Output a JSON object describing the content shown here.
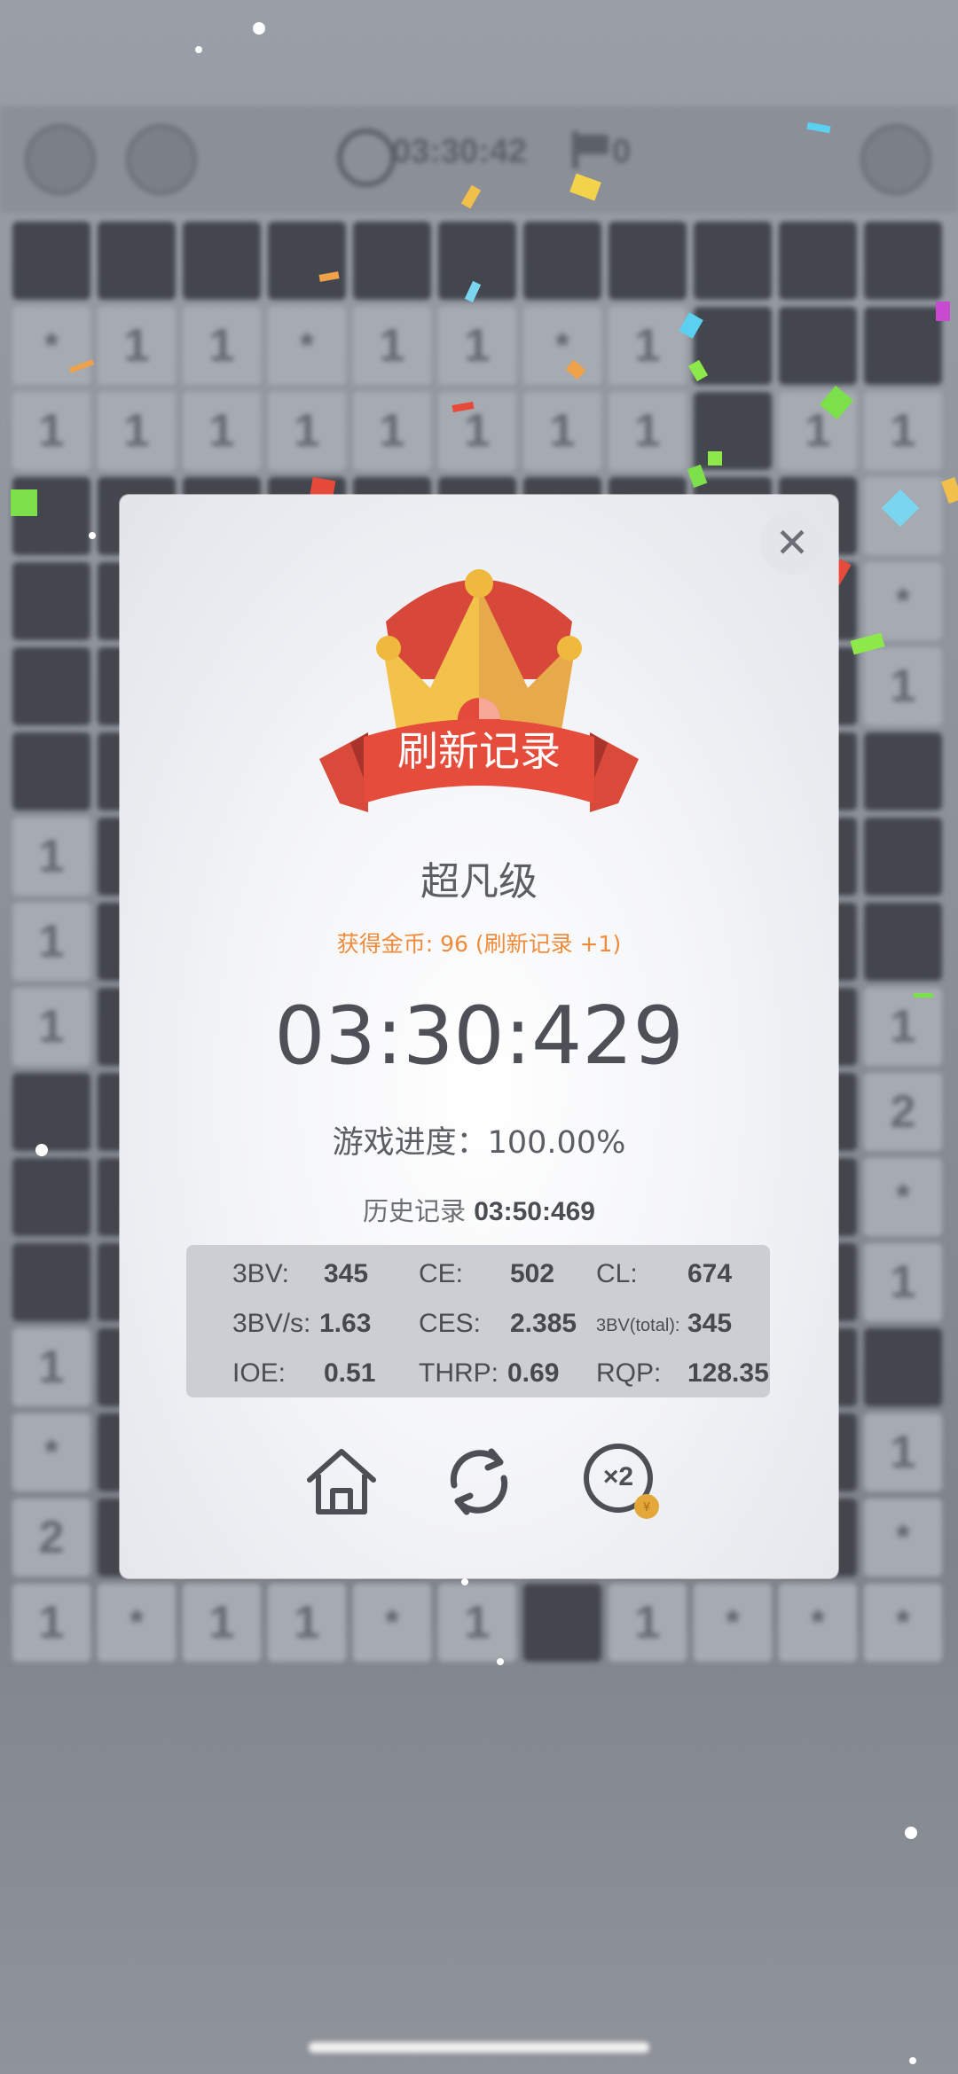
{
  "topbar": {
    "timer": "03:30:42",
    "flags": "0"
  },
  "board": {
    "rows": [
      [
        "",
        "",
        "",
        "",
        "",
        "",
        "",
        "",
        "",
        "",
        ""
      ],
      [
        "*",
        "1",
        "1",
        "*",
        "1",
        "1",
        "*",
        "1",
        "",
        "",
        ""
      ],
      [
        "1",
        "1",
        "1",
        "1",
        "1",
        "1",
        "1",
        "1",
        "",
        "1",
        "1"
      ],
      [
        "",
        "",
        "",
        "",
        "",
        "",
        "",
        "",
        "",
        "",
        "*"
      ],
      [
        "",
        "",
        "",
        "",
        "",
        "",
        "",
        "",
        "",
        "",
        "*"
      ],
      [
        "",
        "",
        "",
        "",
        "",
        "",
        "",
        "",
        "",
        "",
        "1"
      ],
      [
        "",
        "",
        "",
        "",
        "",
        "",
        "",
        "",
        "",
        "",
        ""
      ],
      [
        "1",
        "",
        "",
        "",
        "",
        "",
        "",
        "",
        "",
        "",
        ""
      ],
      [
        "1",
        "",
        "",
        "",
        "",
        "",
        "",
        "",
        "",
        "",
        ""
      ],
      [
        "1",
        "",
        "",
        "",
        "",
        "",
        "",
        "",
        "",
        "",
        "1"
      ],
      [
        "",
        "",
        "",
        "",
        "",
        "",
        "",
        "",
        "",
        "",
        "2"
      ],
      [
        "",
        "",
        "",
        "",
        "",
        "",
        "",
        "",
        "",
        "",
        "*"
      ],
      [
        "",
        "",
        "",
        "",
        "",
        "",
        "",
        "",
        "",
        "",
        "1"
      ],
      [
        "1",
        "",
        "",
        "",
        "",
        "",
        "",
        "",
        "",
        "",
        ""
      ],
      [
        "*",
        "",
        "",
        "",
        "",
        "",
        "",
        "",
        "",
        "",
        "1"
      ],
      [
        "2",
        "",
        "",
        "",
        "",
        "",
        "",
        "",
        "",
        "",
        "*"
      ],
      [
        "1",
        "*",
        "1",
        "1",
        "*",
        "1",
        "",
        "1",
        "*",
        "*",
        "*"
      ]
    ]
  },
  "dialog": {
    "close_icon": "close-icon",
    "banner_text": "刷新记录",
    "level_title": "超凡级",
    "coins_text": "获得金币: 96 (刷新记录 +1)",
    "time": "03:30:429",
    "progress_text": "游戏进度：100.00%",
    "history_label": "历史记录",
    "history_value": "03:50:469",
    "stats": {
      "bv_label": "3BV:",
      "bv_value": "345",
      "ce_label": "CE:",
      "ce_value": "502",
      "cl_label": "CL:",
      "cl_value": "674",
      "bvs_label": "3BV/s:",
      "bvs_value": "1.63",
      "ces_label": "CES:",
      "ces_value": "2.385",
      "bvtotal_label": "3BV(total):",
      "bvtotal_value": "345",
      "ioe_label": "IOE:",
      "ioe_value": "0.51",
      "thrp_label": "THRP:",
      "thrp_value": "0.69",
      "rqp_label": "RQP:",
      "rqp_value": "128.35"
    },
    "actions": {
      "home_icon": "home-icon",
      "restart_icon": "refresh-icon",
      "double_icon": "x2-icon",
      "double_text": "×2"
    }
  },
  "colors": {
    "accent_orange": "#ef8c3c",
    "banner_red": "#e24a3b",
    "crown_gold": "#f2c24a"
  }
}
